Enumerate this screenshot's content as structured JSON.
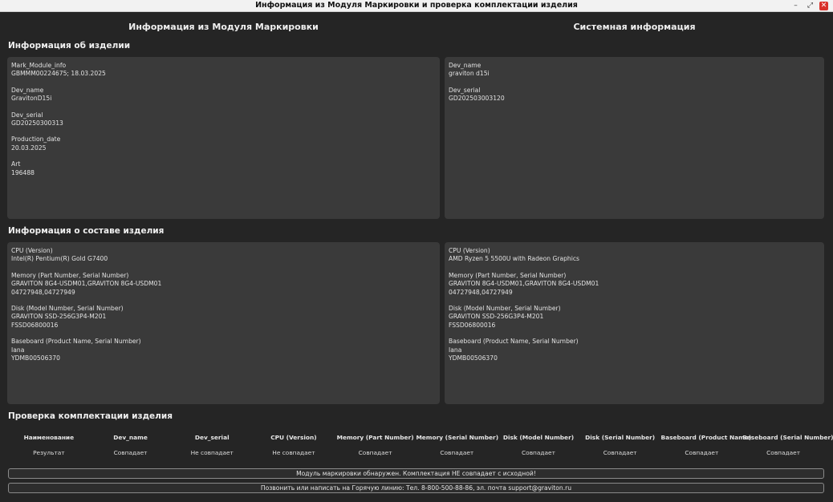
{
  "window": {
    "title": "Информация из Модуля Маркировки и проверка комплектации изделия",
    "min_glyph": "–",
    "max_glyph": "⤢",
    "close_glyph": "✕"
  },
  "columns": {
    "module": "Информация из Модуля Маркировки",
    "system": "Системная информация"
  },
  "sections": {
    "device": "Информация об изделии",
    "composition": "Информация о составе изделия",
    "check": "Проверка комплектации изделия"
  },
  "device_module": [
    {
      "key": "Mark_Module_info",
      "value": "GBMMM00224675; 18.03.2025"
    },
    {
      "key": "Dev_name",
      "value": "GravitonD15i"
    },
    {
      "key": "Dev_serial",
      "value": "GD20250300313"
    },
    {
      "key": "Production_date",
      "value": "20.03.2025"
    },
    {
      "key": "Art",
      "value": "196488"
    }
  ],
  "device_system": [
    {
      "key": "Dev_name",
      "value": "graviton d15i"
    },
    {
      "key": "Dev_serial",
      "value": "GD202503003120"
    }
  ],
  "composition_module": [
    {
      "key": "CPU (Version)",
      "value": "Intel(R) Pentium(R) Gold G7400"
    },
    {
      "key": "Memory (Part Number, Serial Number)",
      "value": "GRAVITON 8G4-USDM01,GRAVITON 8G4-USDM01",
      "value2": "04727948,04727949"
    },
    {
      "key": "Disk (Model Number, Serial Number)",
      "value": "GRAVITON SSD-256G3P4-M201",
      "value2": "FSSD06800016"
    },
    {
      "key": "Baseboard (Product Name, Serial Number)",
      "value": "Iana",
      "value2": "YDMB00506370"
    }
  ],
  "composition_system": [
    {
      "key": "CPU (Version)",
      "value": "AMD Ryzen 5 5500U with Radeon Graphics"
    },
    {
      "key": "Memory (Part Number, Serial Number)",
      "value": "GRAVITON 8G4-USDM01,GRAVITON 8G4-USDM01",
      "value2": "04727948,04727949"
    },
    {
      "key": "Disk (Model Number, Serial Number)",
      "value": "GRAVITON SSD-256G3P4-M201",
      "value2": "FSSD06800016"
    },
    {
      "key": "Baseboard (Product Name, Serial Number)",
      "value": "Iana",
      "value2": "YDMB00506370"
    }
  ],
  "check_table": {
    "headers": [
      "Наименование",
      "Dev_name",
      "Dev_serial",
      "CPU (Version)",
      "Memory (Part Number)",
      "Memory (Serial Number)",
      "Disk (Model Number)",
      "Disk (Serial Number)",
      "Baseboard (Product Name)",
      "Baseboard (Serial Number)"
    ],
    "row": [
      "Результат",
      "Совпадает",
      "Не совпадает",
      "Не совпадает",
      "Совпадает",
      "Совпадает",
      "Совпадает",
      "Совпадает",
      "Совпадает",
      "Совпадает"
    ]
  },
  "status_message": "Модуль маркировки обнаружен. Комплектация НЕ совпадает с исходной!",
  "hotline_message": "Позвонить или написать на Горячую линию: Тел. 8-800-500-88-86, эл. почта support@graviton.ru"
}
